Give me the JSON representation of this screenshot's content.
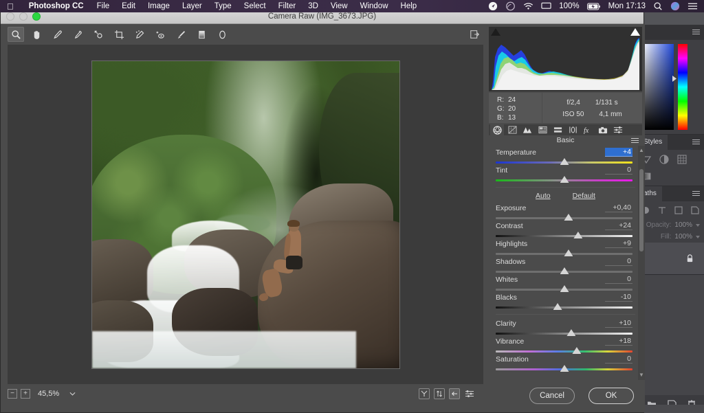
{
  "menubar": {
    "apple_icon": "apple-logo-icon",
    "app_name": "Photoshop CC",
    "items": [
      "File",
      "Edit",
      "Image",
      "Layer",
      "Type",
      "Select",
      "Filter",
      "3D",
      "View",
      "Window",
      "Help"
    ],
    "status": {
      "location_icon": "location-arrow-icon",
      "creative_cloud_icon": "creative-cloud-icon",
      "wifi_icon": "wifi-icon",
      "airplay_icon": "airplay-icon",
      "battery_percent": "100%",
      "battery_icon": "battery-charging-icon",
      "clock": "Mon 17:13",
      "search_icon": "search-icon",
      "siri_icon": "siri-icon",
      "notification_icon": "notification-center-icon"
    }
  },
  "camera_raw": {
    "title": "Camera Raw (IMG_3673.JPG)",
    "window_controls": [
      "close-button",
      "minimize-button",
      "zoom-button"
    ],
    "toolbar": [
      {
        "name": "zoom-tool",
        "selected": true
      },
      {
        "name": "hand-tool",
        "selected": false
      },
      {
        "name": "white-balance-tool",
        "selected": false
      },
      {
        "name": "color-sampler-tool",
        "selected": false
      },
      {
        "name": "targeted-adjustment-tool",
        "selected": false
      },
      {
        "name": "crop-tool",
        "selected": false
      },
      {
        "name": "spot-removal-tool",
        "selected": false
      },
      {
        "name": "red-eye-removal-tool",
        "selected": false
      },
      {
        "name": "adjustment-brush-tool",
        "selected": false
      },
      {
        "name": "graduated-filter-tool",
        "selected": false
      },
      {
        "name": "radial-filter-tool",
        "selected": false
      }
    ],
    "preferences_icon": "open-preferences-dialog-icon",
    "histogram": {
      "shadow_clipping_icon": "shadow-clipping-warning",
      "highlight_clipping_icon": "highlight-clipping-warning"
    },
    "readout": {
      "r_label": "R:",
      "r_value": "24",
      "g_label": "G:",
      "g_value": "20",
      "b_label": "B:",
      "b_value": "13",
      "aperture": "f/2,4",
      "shutter": "1/131 s",
      "iso": "ISO 50",
      "focal": "4,1 mm"
    },
    "tabs": [
      {
        "name": "basic-tab",
        "icon": "aperture-icon",
        "active": true
      },
      {
        "name": "tone-curve-tab",
        "icon": "tone-curve-icon",
        "active": false
      },
      {
        "name": "detail-tab",
        "icon": "triangles-icon",
        "active": false
      },
      {
        "name": "hsl-grayscale-tab",
        "icon": "hsl-icon",
        "active": false
      },
      {
        "name": "split-toning-tab",
        "icon": "split-toning-icon",
        "active": false
      },
      {
        "name": "lens-corrections-tab",
        "icon": "lens-icon",
        "active": false
      },
      {
        "name": "effects-tab",
        "icon": "fx-icon",
        "active": false
      },
      {
        "name": "camera-calibration-tab",
        "icon": "camera-icon",
        "active": false
      },
      {
        "name": "presets-tab",
        "icon": "presets-sliders-icon",
        "active": false
      }
    ],
    "panel": {
      "title": "Basic",
      "menu_icon": "panel-menu-icon",
      "auto_label": "Auto",
      "default_label": "Default",
      "white_balance_sliders": [
        {
          "label": "Temperature",
          "value": "+4",
          "pos": 50,
          "track": "grad-temp",
          "selected": true
        },
        {
          "label": "Tint",
          "value": "0",
          "pos": 50,
          "track": "grad-tint",
          "selected": false
        }
      ],
      "tone_sliders": [
        {
          "label": "Exposure",
          "value": "+0,40",
          "pos": 53,
          "track": "plain",
          "selected": false
        },
        {
          "label": "Contrast",
          "value": "+24",
          "pos": 60,
          "track": "grad-bw",
          "selected": false
        },
        {
          "label": "Highlights",
          "value": "+9",
          "pos": 53,
          "track": "plain",
          "selected": false
        },
        {
          "label": "Shadows",
          "value": "0",
          "pos": 50,
          "track": "plain",
          "selected": false
        },
        {
          "label": "Whites",
          "value": "0",
          "pos": 50,
          "track": "plain",
          "selected": false
        },
        {
          "label": "Blacks",
          "value": "-10",
          "pos": 45,
          "track": "grad-bw",
          "selected": false
        }
      ],
      "presence_sliders": [
        {
          "label": "Clarity",
          "value": "+10",
          "pos": 55,
          "track": "grad-bw",
          "selected": false
        },
        {
          "label": "Vibrance",
          "value": "+18",
          "pos": 59,
          "track": "grad-vib",
          "selected": false
        },
        {
          "label": "Saturation",
          "value": "0",
          "pos": 50,
          "track": "grad-sat",
          "selected": false
        }
      ]
    },
    "zoombar": {
      "minus_label": "−",
      "plus_label": "+",
      "zoom_value": "45,5%",
      "dropdown_icon": "chevron-down-icon",
      "view_buttons": [
        {
          "name": "toggle-yuv-preview-button",
          "label": "Y",
          "on": false
        },
        {
          "name": "toggle-before-after-button",
          "label": "⇅",
          "on": false
        },
        {
          "name": "swap-before-after-button",
          "label": "←",
          "on": true
        },
        {
          "name": "preview-preferences-button",
          "label": "sliders-icon",
          "on": false
        }
      ]
    },
    "footer": {
      "cancel_label": "Cancel",
      "ok_label": "OK"
    },
    "photo": {
      "description": "Shirtless man sitting on a rock beside a jungle waterfall",
      "filename": "IMG_3673.JPG"
    }
  },
  "photoshop_panels": {
    "color_panel": {
      "menu_icon": "panel-menu-icon",
      "picker_icon": "color-picker-field",
      "hue_icon": "hue-strip"
    },
    "styles_panel": {
      "tab_label": "Styles",
      "menu_icon": "panel-menu-icon"
    },
    "paths_panel": {
      "tab_label": "aths",
      "menu_icon": "panel-menu-icon"
    },
    "layers_panel": {
      "opacity_label": "Opacity:",
      "opacity_value": "100%",
      "fill_label": "Fill:",
      "fill_value": "100%",
      "lock_icon": "lock-icon",
      "footer_icons": [
        "new-group-icon",
        "new-layer-icon",
        "delete-layer-icon"
      ]
    }
  }
}
